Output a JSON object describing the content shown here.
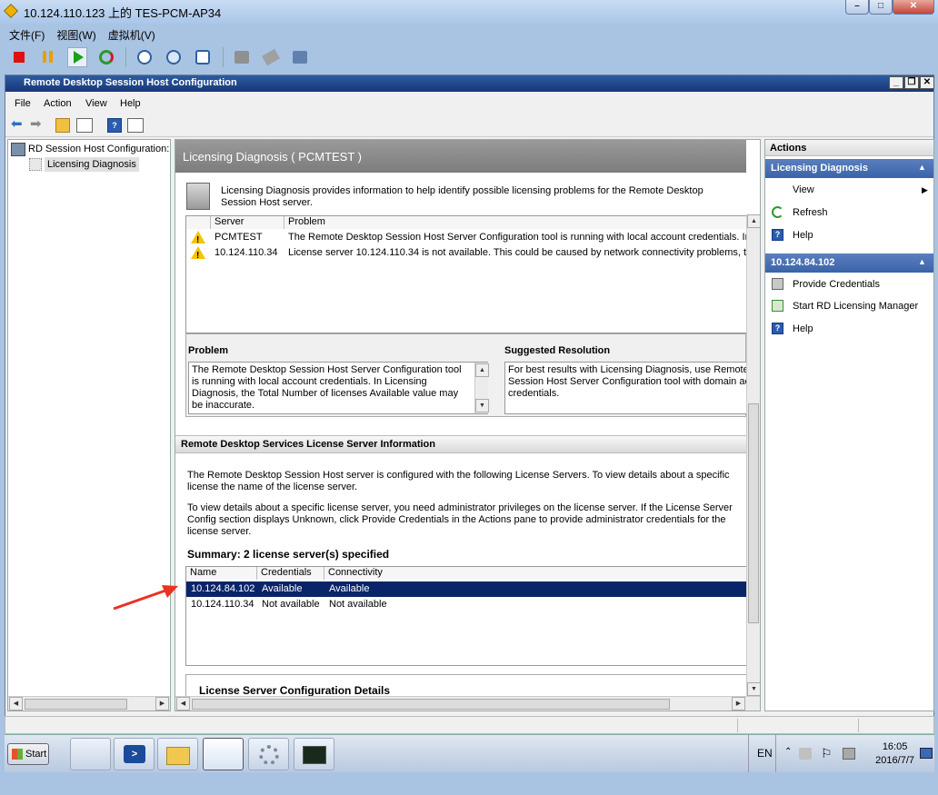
{
  "vm": {
    "title": "10.124.110.123 上的 TES-PCM-AP34",
    "menu": [
      "文件(F)",
      "视图(W)",
      "虚拟机(V)"
    ]
  },
  "mmc": {
    "title": "Remote Desktop Session Host Configuration",
    "menu": [
      "File",
      "Action",
      "View",
      "Help"
    ]
  },
  "tree": {
    "root": "RD Session Host Configuration:",
    "child": "Licensing Diagnosis"
  },
  "center": {
    "header": "Licensing Diagnosis ( PCMTEST )",
    "intro": "Licensing Diagnosis provides information to help identify possible licensing problems for the Remote Desktop Session Host server.",
    "grid_headers": [
      "Server",
      "Problem"
    ],
    "grid_rows": [
      {
        "server": "PCMTEST",
        "problem": "The Remote Desktop Session Host Server Configuration tool is running with local account credentials. In Li"
      },
      {
        "server": "10.124.110.34",
        "problem": "License server 10.124.110.34 is not available. This could be caused by network connectivity problems, the"
      }
    ],
    "problem_label": "Problem",
    "problem_text": "The Remote Desktop Session Host Server Configuration tool is running with local account credentials. In Licensing Diagnosis, the Total Number of licenses Available value may be inaccurate.",
    "resolution_label": "Suggested Resolution",
    "resolution_text": "For best results with Licensing Diagnosis, use Remote D Session Host Server Configuration tool with domain acco credentials.",
    "ls_section_title": "Remote Desktop Services License Server Information",
    "ls_para1": "The Remote Desktop Session Host server is configured with the following License Servers. To view details about a specific license the name of the license server.",
    "ls_para2": "To view details about a specific license server, you need administrator privileges on the license server. If the License Server Config section displays Unknown, click Provide Credentials in the Actions pane to provide administrator credentials for the license server.",
    "summary": "Summary: 2 license server(s) specified",
    "ls_headers": [
      "Name",
      "Credentials",
      "Connectivity"
    ],
    "ls_rows": [
      {
        "name": "10.124.84.102",
        "credentials": "Available",
        "connectivity": "Available"
      },
      {
        "name": "10.124.110.34",
        "credentials": "Not available",
        "connectivity": "Not available"
      }
    ],
    "details_title": "License Server Configuration Details"
  },
  "actions": {
    "title": "Actions",
    "section1": "Licensing Diagnosis",
    "view": "View",
    "refresh": "Refresh",
    "help1": "Help",
    "section2": "10.124.84.102",
    "provide": "Provide Credentials",
    "start_mgr": "Start RD Licensing Manager",
    "help2": "Help"
  },
  "taskbar": {
    "start": "Start",
    "lang": "EN",
    "time": "16:05",
    "date": "2016/7/7"
  },
  "colors": {
    "selection": "#0a246a",
    "accent": "#3a63a8"
  }
}
